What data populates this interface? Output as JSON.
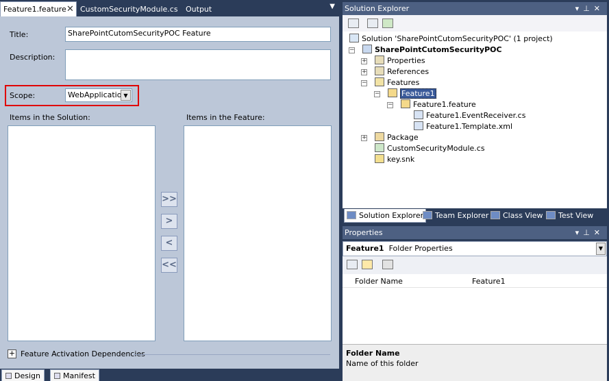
{
  "doc_tabs": [
    {
      "label": "Feature1.feature",
      "active": true
    },
    {
      "label": "CustomSecurityModule.cs",
      "active": false
    },
    {
      "label": "Output",
      "active": false
    }
  ],
  "designer": {
    "title_label": "Title:",
    "title_value": "SharePointCutomSecurityPOC Feature",
    "description_label": "Description:",
    "description_value": "",
    "scope_label": "Scope:",
    "scope_value": "WebApplication",
    "items_solution_label": "Items in the Solution:",
    "items_feature_label": "Items in the Feature:",
    "move_buttons": [
      ">>",
      ">",
      "<",
      "<<"
    ],
    "dependencies_label": "Feature Activation Dependencies",
    "highlight_color": "#e00000"
  },
  "view_tabs": [
    {
      "label": "Design"
    },
    {
      "label": "Manifest"
    }
  ],
  "solution_explorer": {
    "title": "Solution Explorer",
    "tree": [
      {
        "label": "Solution 'SharePointCutomSecurityPOC' (1 project)",
        "icon": "solution-icon"
      },
      {
        "label": "SharePointCutomSecurityPOC",
        "icon": "project-icon",
        "bold": true
      },
      {
        "label": "Properties",
        "icon": "properties-folder-icon"
      },
      {
        "label": "References",
        "icon": "references-icon"
      },
      {
        "label": "Features",
        "icon": "folder-open-icon"
      },
      {
        "label": "Feature1",
        "icon": "feature-icon",
        "selected": true
      },
      {
        "label": "Feature1.feature",
        "icon": "feature-file-icon"
      },
      {
        "label": "Feature1.EventReceiver.cs",
        "icon": "cs-file-icon"
      },
      {
        "label": "Feature1.Template.xml",
        "icon": "xml-file-icon"
      },
      {
        "label": "Package",
        "icon": "package-icon"
      },
      {
        "label": "CustomSecurityModule.cs",
        "icon": "cs-file-icon"
      },
      {
        "label": "key.snk",
        "icon": "key-icon"
      }
    ],
    "bottom_tabs": [
      {
        "label": "Solution Explorer",
        "active": true
      },
      {
        "label": "Team Explorer",
        "active": false
      },
      {
        "label": "Class View",
        "active": false
      },
      {
        "label": "Test View",
        "active": false
      }
    ]
  },
  "properties": {
    "title": "Properties",
    "object_name": "Feature1",
    "object_type": "Folder Properties",
    "rows": [
      {
        "name": "Folder Name",
        "value": "Feature1"
      }
    ],
    "help_title": "Folder Name",
    "help_text": "Name of this folder"
  }
}
